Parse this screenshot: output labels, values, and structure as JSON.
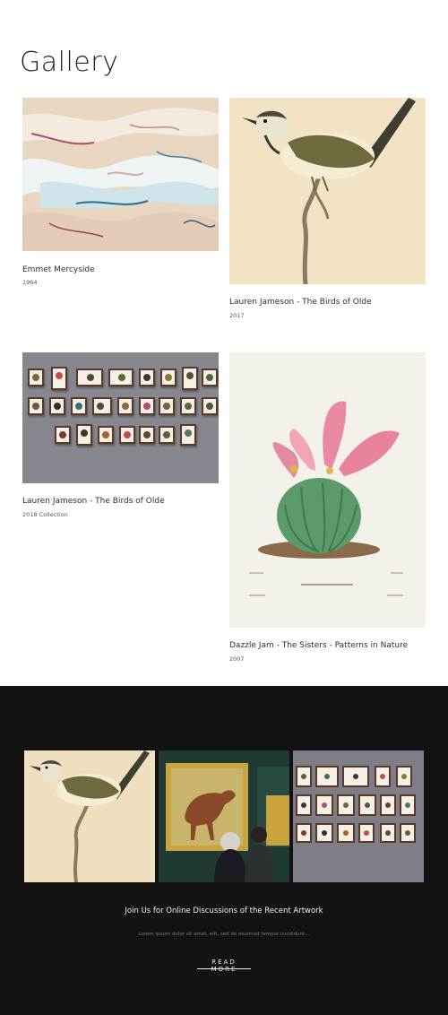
{
  "page": {
    "title": "Gallery"
  },
  "items": [
    {
      "caption": "Emmet Mercyside",
      "meta": "1964",
      "image": "abstract-paint-texture"
    },
    {
      "caption": "Lauren Jameson - The Birds of Olde",
      "meta": "2017",
      "image": "bird-illustration"
    },
    {
      "caption": "Lauren Jameson - The Birds of Olde",
      "meta": "2018 Collection",
      "image": "framed-prints-wall"
    },
    {
      "caption": "Dazzle Jam - The Sisters - Patterns in Nature",
      "meta": "2007",
      "image": "cactus-illustration"
    }
  ],
  "footer": {
    "images": [
      "bird-illustration",
      "museum-horse-painting",
      "framed-prints-wall"
    ],
    "heading": "Join Us for Online Discussions of the Recent Artwork",
    "body": "Lorem ipsum dolor sit amet, elit, sed do eiusmod tempor incididunt...",
    "cta": "READ MORE"
  },
  "colors": {
    "background": "#ffffff",
    "footer_bg": "#121212",
    "text": "#2a2a2a"
  }
}
